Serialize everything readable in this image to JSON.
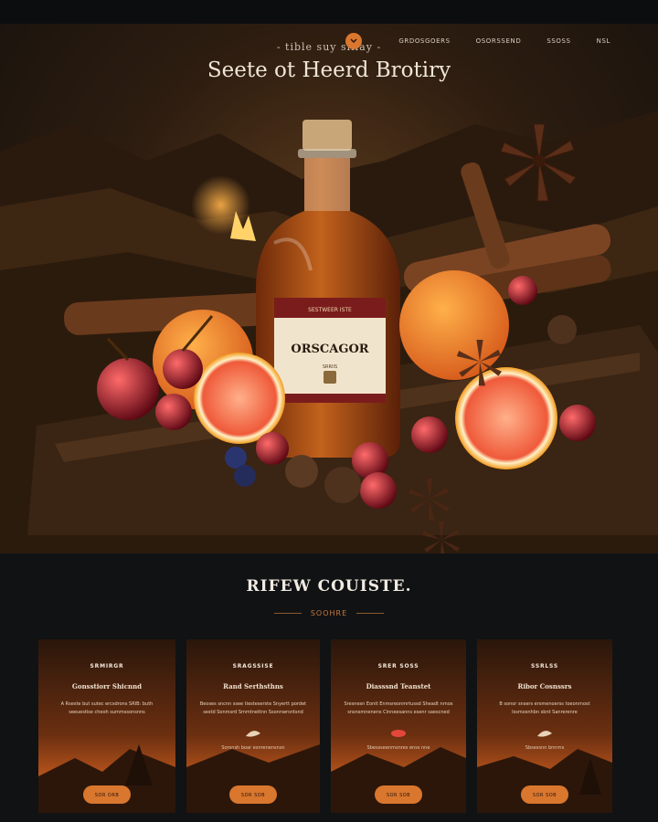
{
  "nav": {
    "links": [
      "GRDOSGOERS",
      "OSORSSEND",
      "SSOSS",
      "NSL"
    ],
    "accent": "#d9772e"
  },
  "hero": {
    "tagline": "- tible suy sliiay -",
    "title": "Seete ot Heerd Brotiry",
    "bottle_label_top": "SESTWEER ISTE",
    "bottle_label_brand": "ORSCAGOR",
    "bottle_label_small": "SRRIIS"
  },
  "section": {
    "title": "RIFEW COUISTE.",
    "subtitle": "SOOHRE"
  },
  "cards": [
    {
      "title": "SRMIRGR",
      "subtitle": "Gonsstiorr Shicnnd",
      "text": "A Rseste but sutec ercsdrons SRIB: buth seeuestise cheoh summssonsnns",
      "note": "",
      "button": "SOR ORB"
    },
    {
      "title": "SRAGSSISE",
      "subtitle": "Rand Serthsthns",
      "text": "Beoses sncnn ssee tiesteserste Snyertt pordet sestd Sonmsrd Smmtnettnn Ssonnwrsntsnd",
      "note": "Sorsnsh boar esnrenensnsn",
      "button": "SOR SOB"
    },
    {
      "title": "SRER SOSS",
      "subtitle": "Diasssnd Teanstet",
      "text": "Sresnesn Eonit Enmsreonmrtussd Sheadt nrnos snsnsmnenens Cinneesanns esenr saescned",
      "note": "Sbessseenmsnres enss nne",
      "button": "SOR SOB"
    },
    {
      "title": "SSRLSS",
      "subtitle": "Ribor Cosnssrs",
      "text": "B sonor snsers ersmenoerss toeonrnost Issmosnhbn sbnt Sanrerenre",
      "note": "Sbsessnn bnnrns",
      "button": "SOR SOB"
    }
  ]
}
